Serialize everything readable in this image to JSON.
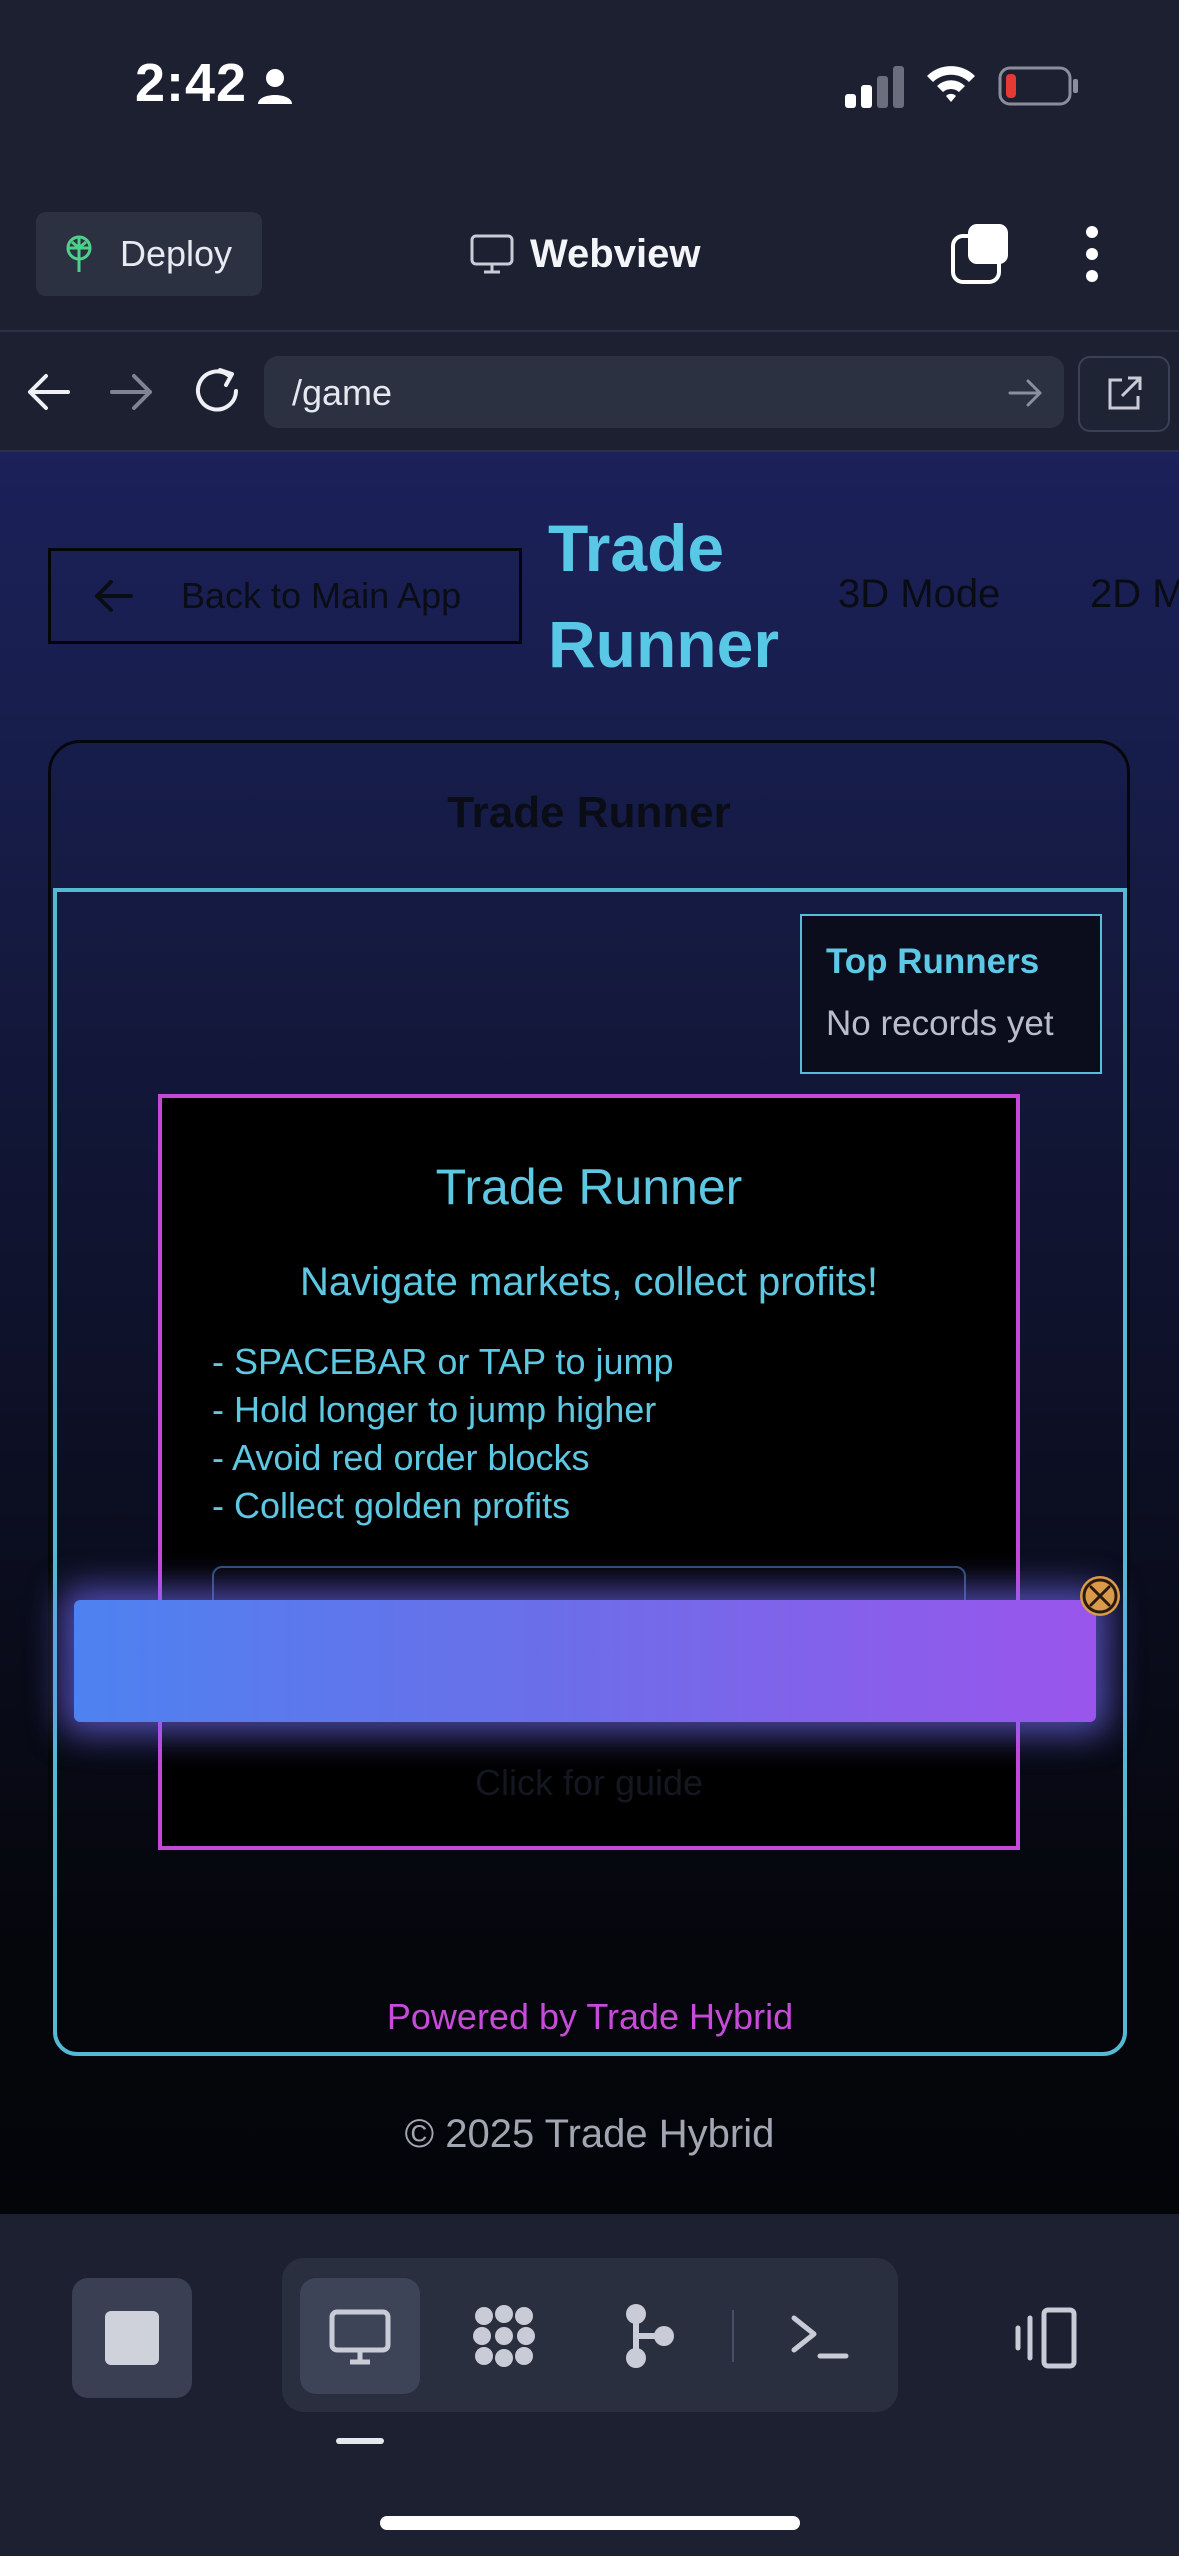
{
  "status_bar": {
    "time": "2:42",
    "icons": [
      "person-icon",
      "signal-icon",
      "wifi-icon",
      "battery-low-icon"
    ],
    "battery_color": "#e53935"
  },
  "top_bar": {
    "deploy_label": "Deploy",
    "title": "Webview",
    "icons": [
      "deploy-icon",
      "monitor-icon",
      "tabs-icon",
      "more-vertical-icon"
    ]
  },
  "url_bar": {
    "url": "/game",
    "icons": [
      "back-arrow-icon",
      "forward-arrow-icon",
      "reload-icon",
      "go-arrow-icon",
      "external-link-icon"
    ]
  },
  "page": {
    "back_label": "Back to Main App",
    "app_title": "Trade Runner",
    "mode_3d": "3D Mode",
    "mode_2d": "2D M",
    "card_title": "Trade Runner",
    "leaderboard": {
      "title": "Top Runners",
      "empty": "No records yet"
    },
    "start_panel": {
      "title": "Trade Runner",
      "subtitle": "Navigate markets, collect profits!",
      "instructions": [
        "- SPACEBAR or TAP to jump",
        "- Hold longer to jump higher",
        "- Avoid red order blocks",
        "- Collect golden profits"
      ],
      "guide_text": "Click for guide"
    },
    "powered_by": "Powered by Trade Hybrid",
    "copyright": "© 2025 Trade Hybrid"
  },
  "colors": {
    "accent_cyan": "#59c8e6",
    "accent_magenta": "#c548d8",
    "banner_start": "#4e82f0",
    "banner_end": "#9a55ec"
  },
  "bottom_toolbar": {
    "icons": [
      "stop-icon",
      "monitor-icon",
      "dots-grid-icon",
      "git-branch-icon",
      "terminal-icon",
      "side-panel-icon"
    ],
    "active": "monitor-icon"
  }
}
